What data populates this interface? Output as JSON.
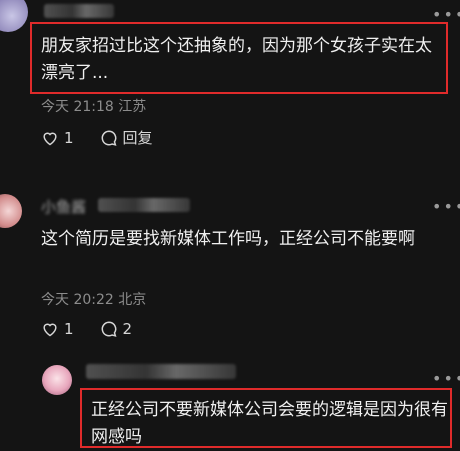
{
  "comments": [
    {
      "text": "朋友家招过比这个还抽象的，因为那个女孩子实在太漂亮了...",
      "time": "今天 21:18",
      "location": "江苏",
      "likes": "1",
      "reply_label": "回复"
    },
    {
      "username": "小鱼酱",
      "text": "这个简历是要找新媒体工作吗，正经公司不能要啊",
      "time": "今天 20:22",
      "location": "北京",
      "likes": "1",
      "replies": "2"
    },
    {
      "text": "正经公司不要新媒体公司会要的逻辑是因为很有网感吗"
    }
  ],
  "icons": {
    "more": "more-dots-icon",
    "like": "heart-icon",
    "reply": "speech-bubble-icon"
  },
  "colors": {
    "background": "#141414",
    "highlight_border": "#e02b2b",
    "meta_text": "#8c8c8c"
  }
}
